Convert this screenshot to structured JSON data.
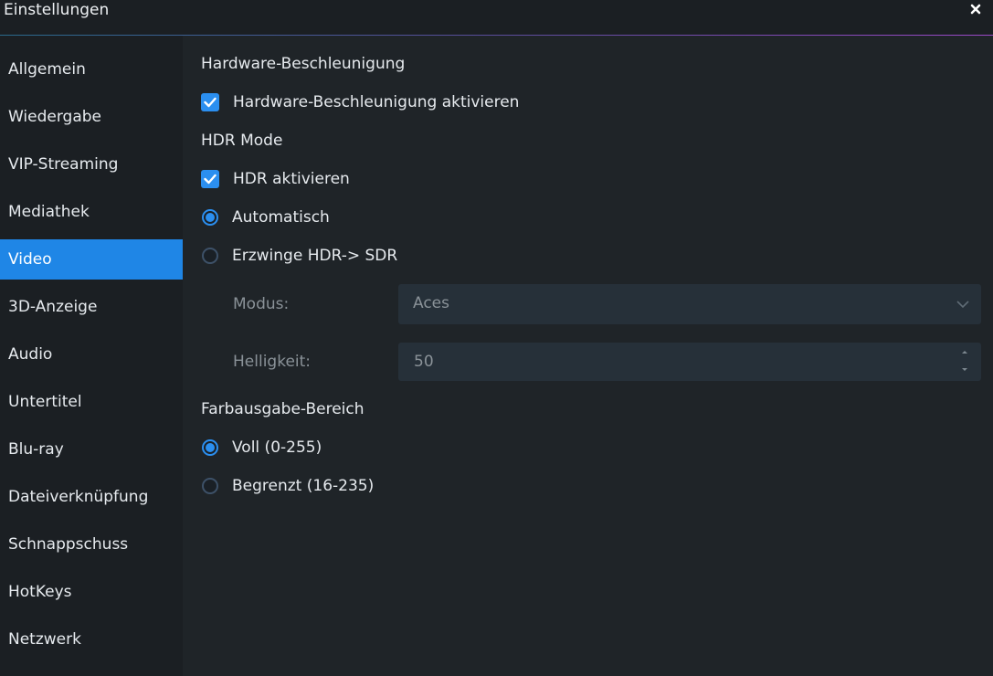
{
  "window": {
    "title": "Einstellungen"
  },
  "sidebar": {
    "items": [
      {
        "label": "Allgemein"
      },
      {
        "label": "Wiedergabe"
      },
      {
        "label": "VIP-Streaming"
      },
      {
        "label": "Mediathek"
      },
      {
        "label": "Video",
        "active": true
      },
      {
        "label": "3D-Anzeige"
      },
      {
        "label": "Audio"
      },
      {
        "label": "Untertitel"
      },
      {
        "label": "Blu-ray"
      },
      {
        "label": "Dateiverknüpfung"
      },
      {
        "label": "Schnappschuss"
      },
      {
        "label": "HotKeys"
      },
      {
        "label": "Netzwerk"
      }
    ]
  },
  "video": {
    "hw_section": "Hardware-Beschleunigung",
    "hw_enable": {
      "label": "Hardware-Beschleunigung aktivieren",
      "checked": true
    },
    "hdr_section": "HDR Mode",
    "hdr_enable": {
      "label": "HDR aktivieren",
      "checked": true
    },
    "hdr_auto": {
      "label": "Automatisch",
      "checked": true
    },
    "hdr_force": {
      "label": "Erzwinge HDR-> SDR",
      "checked": false
    },
    "mode_label": "Modus:",
    "mode_value": "Aces",
    "brightness_label": "Helligkeit:",
    "brightness_value": "50",
    "color_section": "Farbausgabe-Bereich",
    "color_full": {
      "label": "Voll (0-255)",
      "checked": true
    },
    "color_limited": {
      "label": "Begrenzt (16-235)",
      "checked": false
    }
  },
  "colors": {
    "accent": "#1f86e6",
    "checkbox": "#2b8ff0",
    "background": "#1f2428",
    "sidebar": "#1b1f23"
  },
  "icons": {
    "close": "close-icon",
    "check": "checkmark-icon",
    "dropdown": "chevron-down-icon",
    "spin_up": "caret-up-icon",
    "spin_down": "caret-down-icon"
  }
}
